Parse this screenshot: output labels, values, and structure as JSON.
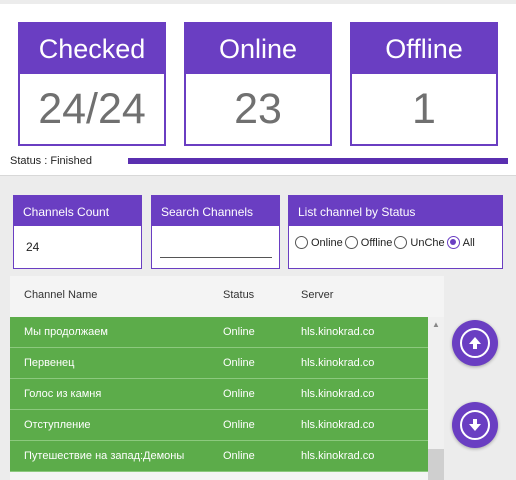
{
  "stats": {
    "checked": {
      "title": "Checked",
      "value": "24/24"
    },
    "online": {
      "title": "Online",
      "value": "23"
    },
    "offline": {
      "title": "Offline",
      "value": "1"
    }
  },
  "status": {
    "text": "Status : Finished",
    "progress_percent": 100
  },
  "controls": {
    "count": {
      "title": "Channels Count",
      "value": "24"
    },
    "search": {
      "title": "Search Channels",
      "value": ""
    },
    "filter": {
      "title": "List channel by Status",
      "options": [
        "Online",
        "Offline",
        "UnChe",
        "All"
      ],
      "selected": "All"
    }
  },
  "table": {
    "headers": {
      "name": "Channel Name",
      "status": "Status",
      "server": "Server"
    },
    "rows": [
      {
        "name": "Мы продолжаем",
        "status": "Online",
        "server": "hls.kinokrad.co"
      },
      {
        "name": "Первенец",
        "status": "Online",
        "server": "hls.kinokrad.co"
      },
      {
        "name": "Голос из камня",
        "status": "Online",
        "server": "hls.kinokrad.co"
      },
      {
        "name": "Отступление",
        "status": "Online",
        "server": "hls.kinokrad.co"
      },
      {
        "name": "Путешествие на запад:Демоны",
        "status": "Online",
        "server": "hls.kinokrad.co"
      }
    ]
  },
  "icons": {
    "scroll_up": "arrow-up-circle-icon",
    "scroll_down": "arrow-down-circle-icon"
  },
  "colors": {
    "accent": "#6a3ec2",
    "online_row": "#5cac4a"
  }
}
